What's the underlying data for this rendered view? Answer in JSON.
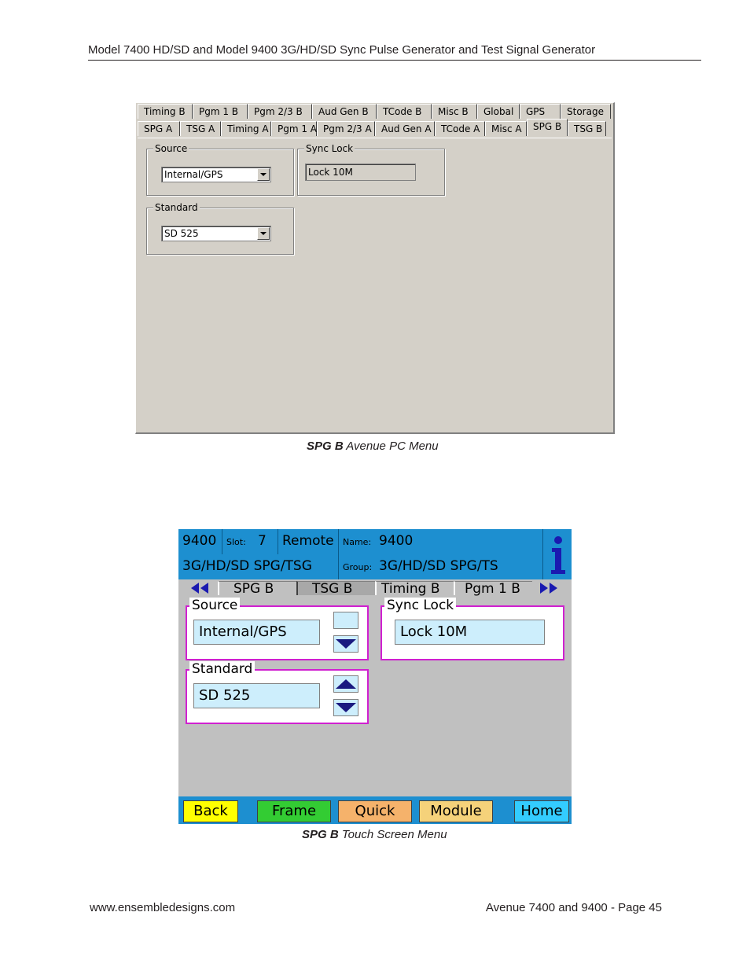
{
  "page": {
    "header": "Model 7400 HD/SD and Model 9400 3G/HD/SD Sync Pulse Generator and Test Signal Generator",
    "footer_left": "www.ensembledesigns.com",
    "footer_right": "Avenue 7400 and 9400 - Page 45"
  },
  "pc_menu": {
    "tabs_row1": [
      "Timing B",
      "Pgm 1 B",
      "Pgm 2/3 B",
      "Aud Gen B",
      "TCode B",
      "Misc B",
      "Global",
      "GPS",
      "Storage"
    ],
    "tabs_row2": [
      "SPG A",
      "TSG A",
      "Timing A",
      "Pgm 1 A",
      "Pgm 2/3 A",
      "Aud Gen A",
      "TCode A",
      "Misc A",
      "SPG B",
      "TSG B"
    ],
    "active_tab": "SPG B",
    "source": {
      "label": "Source",
      "value": "Internal/GPS"
    },
    "sync_lock": {
      "label": "Sync Lock",
      "value": "Lock 10M"
    },
    "standard": {
      "label": "Standard",
      "value": "SD 525"
    },
    "caption_bold": "SPG B",
    "caption_rest": " Avenue PC Menu"
  },
  "touch_menu": {
    "model": "9400",
    "slot_label": "Slot:",
    "slot_value": "7",
    "mode": "Remote",
    "name_label": "Name:",
    "name_value": "9400",
    "type": "3G/HD/SD SPG/TSG",
    "group_label": "Group:",
    "group_value": "3G/HD/SD SPG/TS",
    "tabs": [
      "SPG B",
      "TSG B",
      "Timing B",
      "Pgm 1 B"
    ],
    "active_tab": "TSG B",
    "source": {
      "label": "Source",
      "value": "Internal/GPS"
    },
    "sync_lock": {
      "label": "Sync Lock",
      "value": "Lock 10M"
    },
    "standard": {
      "label": "Standard",
      "value": "SD 525"
    },
    "buttons": [
      {
        "label": "Back",
        "color": "#ffff00"
      },
      {
        "label": "Frame",
        "color": "#33cc33"
      },
      {
        "label": "Quick",
        "color": "#f5b26b"
      },
      {
        "label": "Module",
        "color": "#f5d27a"
      },
      {
        "label": "Home",
        "color": "#33ccff"
      }
    ],
    "caption_bold": "SPG B",
    "caption_rest": " Touch Screen Menu"
  }
}
